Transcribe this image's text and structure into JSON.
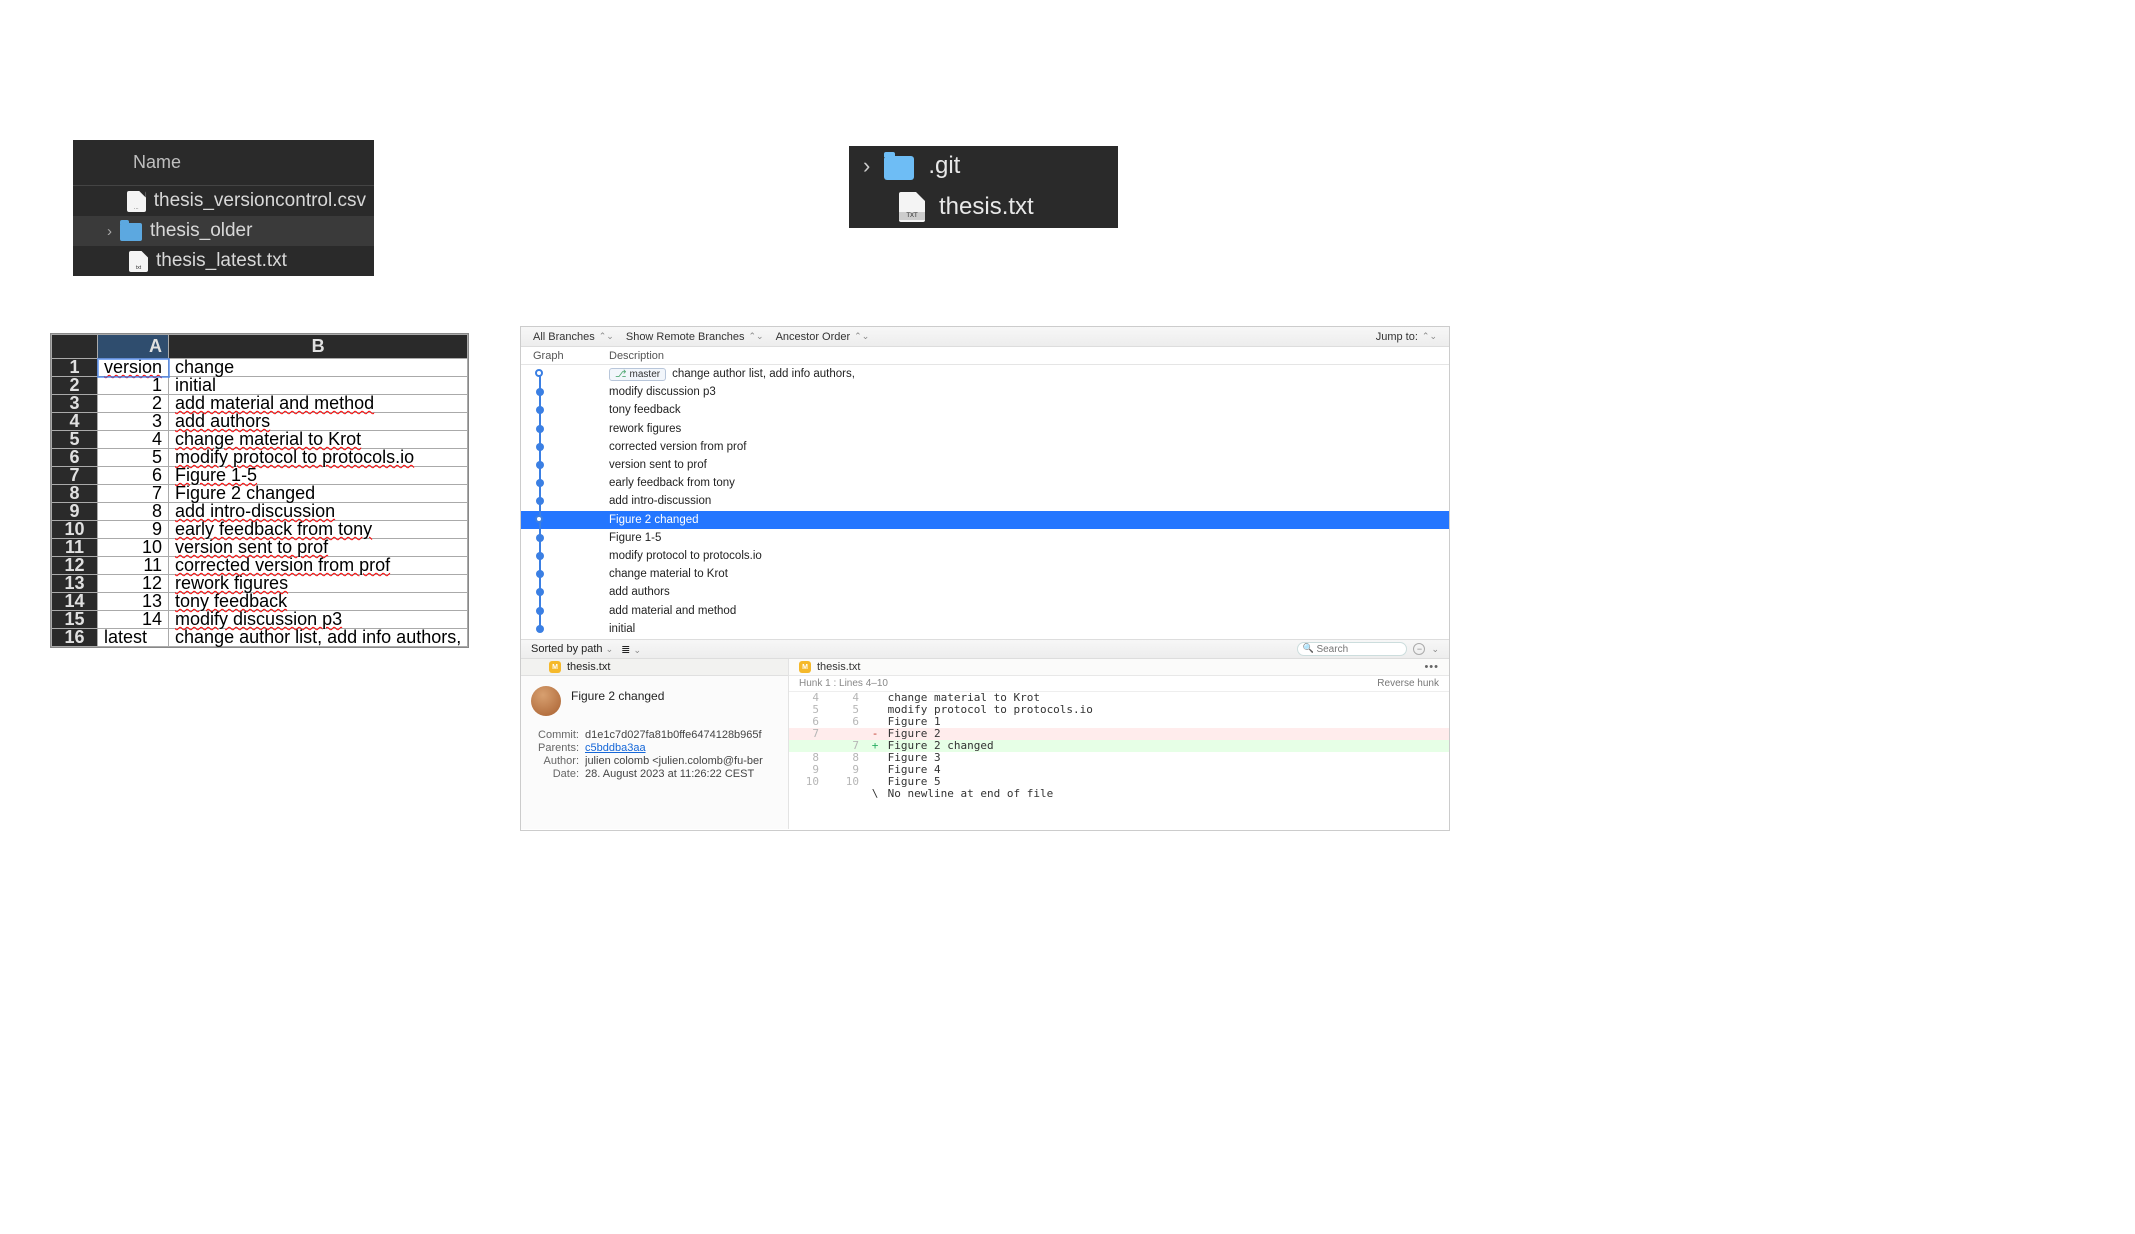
{
  "finder1": {
    "header": "Name",
    "items": [
      {
        "name": "thesis_versioncontrol.csv",
        "kind": "file",
        "badge": "…"
      },
      {
        "name": "thesis_older",
        "kind": "folder"
      },
      {
        "name": "thesis_latest.txt",
        "kind": "file",
        "badge": "txt"
      }
    ]
  },
  "finder2": {
    "items": [
      {
        "name": ".git",
        "kind": "folder"
      },
      {
        "name": "thesis.txt",
        "kind": "file",
        "badge": "TXT"
      }
    ]
  },
  "sheet": {
    "cols": [
      "A",
      "B"
    ],
    "header_row": {
      "a": "version",
      "b": "change"
    },
    "rows": [
      {
        "a": "1",
        "b": "initial"
      },
      {
        "a": "2",
        "b": "add material and method"
      },
      {
        "a": "3",
        "b": "add authors"
      },
      {
        "a": "4",
        "b": "change material to Krot"
      },
      {
        "a": "5",
        "b": "modify protocol to protocols.io"
      },
      {
        "a": "6",
        "b": "Figure 1-5"
      },
      {
        "a": "7",
        "b": "Figure 2 changed"
      },
      {
        "a": "8",
        "b": "add intro-discussion"
      },
      {
        "a": "9",
        "b": "early feedback from tony"
      },
      {
        "a": "10",
        "b": "version sent to prof"
      },
      {
        "a": "11",
        "b": "corrected version from prof"
      },
      {
        "a": "12",
        "b": "rework figures"
      },
      {
        "a": "13",
        "b": "tony feedback"
      },
      {
        "a": "14",
        "b": "modify discussion p3"
      }
    ],
    "latest_row": {
      "a": "latest",
      "b": "change author list, add info authors,"
    }
  },
  "git": {
    "toolbar": {
      "branches": "All Branches",
      "remote": "Show Remote Branches",
      "order": "Ancestor Order",
      "jump": "Jump to:"
    },
    "cols": {
      "graph": "Graph",
      "desc": "Description"
    },
    "branch_tag": "master",
    "commits": [
      {
        "msg": "change author list, add info authors,",
        "head": true
      },
      {
        "msg": "modify discussion p3"
      },
      {
        "msg": "tony feedback"
      },
      {
        "msg": "rework figures"
      },
      {
        "msg": "corrected version from prof"
      },
      {
        "msg": "version sent to prof"
      },
      {
        "msg": "early feedback from tony"
      },
      {
        "msg": "add intro-discussion"
      },
      {
        "msg": "Figure 2 changed",
        "selected": true
      },
      {
        "msg": "Figure 1-5"
      },
      {
        "msg": "modify protocol to protocols.io"
      },
      {
        "msg": "change material to Krot"
      },
      {
        "msg": "add authors"
      },
      {
        "msg": "add material and method"
      },
      {
        "msg": "initial"
      }
    ],
    "mid": {
      "sort": "Sorted by path",
      "search_ph": "Search"
    },
    "left": {
      "file": "thesis.txt",
      "title": "Figure 2 changed",
      "commit_label": "Commit:",
      "commit_val": "d1e1c7d027fa81b0ffe6474128b965f",
      "parents_label": "Parents:",
      "parents_val": "c5bddba3aa",
      "author_label": "Author:",
      "author_val": "julien colomb <julien.colomb@fu-ber",
      "date_label": "Date:",
      "date_val": "28. August 2023 at 11:26:22 CEST"
    },
    "right": {
      "file": "thesis.txt",
      "hunk": "Hunk 1 : Lines 4–10",
      "reverse": "Reverse hunk",
      "lines": [
        {
          "ol": "4",
          "nl": "4",
          "t": "change material to Krot"
        },
        {
          "ol": "5",
          "nl": "5",
          "t": "modify protocol to protocols.io"
        },
        {
          "ol": "6",
          "nl": "6",
          "t": "Figure 1"
        },
        {
          "ol": "7",
          "nl": "",
          "t": "Figure 2",
          "kind": "del"
        },
        {
          "ol": "",
          "nl": "7",
          "t": "Figure 2 changed",
          "kind": "add"
        },
        {
          "ol": "8",
          "nl": "8",
          "t": "Figure 3"
        },
        {
          "ol": "9",
          "nl": "9",
          "t": "Figure 4"
        },
        {
          "ol": "10",
          "nl": "10",
          "t": "Figure 5"
        },
        {
          "ol": "",
          "nl": "",
          "t": "No newline at end of file",
          "sign": "\\"
        }
      ]
    }
  }
}
